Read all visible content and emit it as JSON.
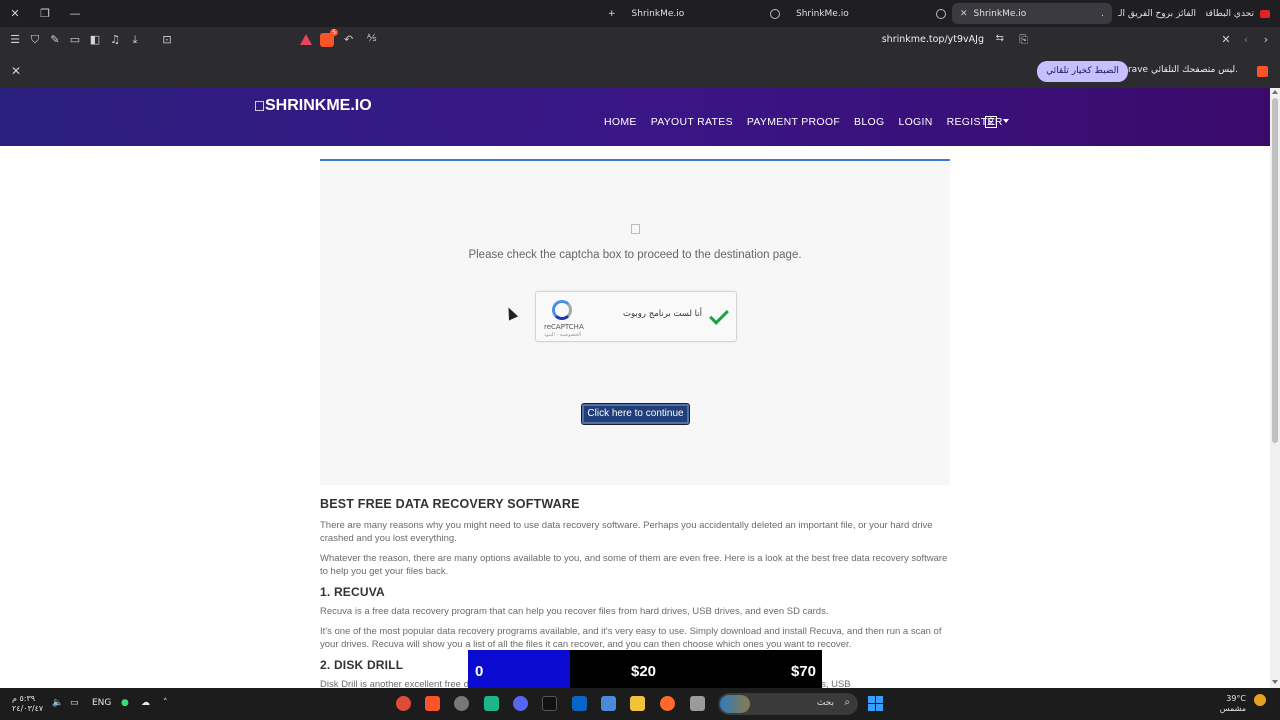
{
  "browser": {
    "tabs": [
      {
        "label": "ShrinkMe.io",
        "active": false
      },
      {
        "label": "ShrinkMe.io",
        "active": false
      },
      {
        "label": "ShrinkMe.io",
        "active": true
      },
      {
        "label": "الفائز بروح الفريق الـ",
        "active": false
      },
      {
        "label": "تحدي البطاقة",
        "active": false
      }
    ],
    "url": "shrinkme.top/yt9vAJg",
    "infobar": {
      "message": "Brave ليس متصفحك التلقائي.",
      "button": "الضبط كخيار تلقائي"
    }
  },
  "site": {
    "logo": "SHRINKME.IO",
    "nav": [
      "HOME",
      "PAYOUT RATES",
      "PAYMENT PROOF",
      "BLOG",
      "LOGIN",
      "REGISTER"
    ]
  },
  "captcha_box": {
    "message": "Please check the captcha box to proceed to the destination page.",
    "checkbox_label": "أنا لست برنامج روبوت",
    "recaptcha": "reCAPTCHA",
    "recaptcha_sub": "الخصوصية - البنود",
    "continue_button": "Click here to continue"
  },
  "article": {
    "title": "BEST FREE DATA RECOVERY SOFTWARE",
    "p1": "There are many reasons why you might need to use data recovery software. Perhaps you accidentally deleted an important file, or your hard drive crashed and you lost everything.",
    "p2": "Whatever the reason, there are many options available to you, and some of them are even free. Here is a look at the best free data recovery software to help you get your files back.",
    "h1": "1. RECUVA",
    "p3": "Recuva is a free data recovery program that can help you recover files from hard drives, USB drives, and even SD cards.",
    "p4": "It's one of the most popular data recovery programs available, and it's very easy to use. Simply download and install Recuva, and then run a scan of your drives. Recuva will show you a list of all the files it can recover, and you can then choose which ones you want to recover.",
    "h2": "2. DISK DRILL",
    "p5": "Disk Drill is another excellent free data recovery program. Like Recuva, it can help you recover lost files from hard drives, USB"
  },
  "ad_overlay": {
    "v1": "0",
    "v2": "$20",
    "v3": "$70"
  },
  "taskbar": {
    "time": "٥:٣٩ م",
    "date": "٢٤/٠٣/٤٧",
    "lang": "ENG",
    "search": "بحث",
    "temp": "39°C",
    "weather": "مشمس"
  }
}
